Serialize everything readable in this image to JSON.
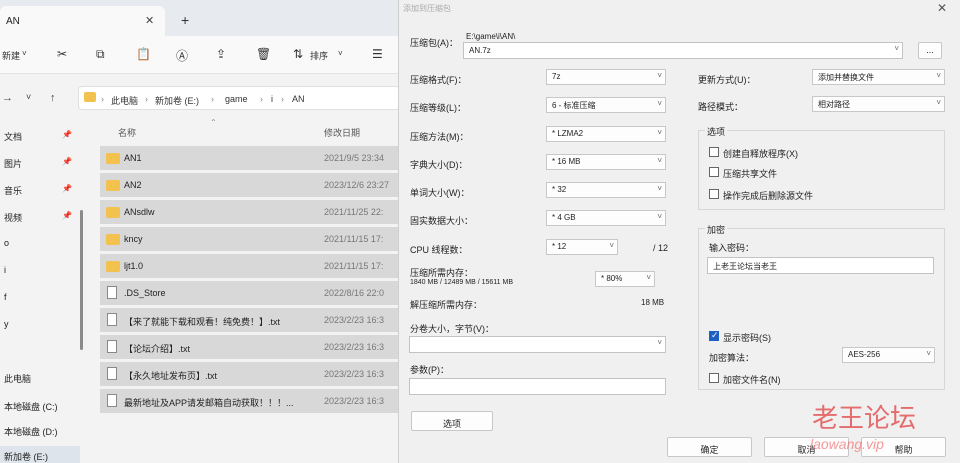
{
  "explorer": {
    "tab_title": "AN",
    "tab_close": "✕",
    "tab_new": "+",
    "toolbar": {
      "new_label": "新建",
      "sort_label": "排序"
    },
    "breadcrumb": [
      "此电脑",
      "新加卷 (E:)",
      "game",
      "i",
      "AN"
    ],
    "sidebar": [
      "文档",
      "图片",
      "音乐",
      "视频",
      "o",
      "i",
      "f",
      "y",
      "此电脑",
      "本地磁盘 (C:)",
      "本地磁盘 (D:)",
      "新加卷 (E:)"
    ],
    "columns": {
      "name": "名称",
      "date": "修改日期"
    },
    "files": [
      {
        "name": "AN1",
        "date": "2021/9/5 23:34",
        "type": "folder"
      },
      {
        "name": "AN2",
        "date": "2023/12/6 23:27",
        "type": "folder"
      },
      {
        "name": "ANsdlw",
        "date": "2021/11/25 22:",
        "type": "folder"
      },
      {
        "name": "kncy",
        "date": "2021/11/15 17:",
        "type": "folder"
      },
      {
        "name": "ljt1.0",
        "date": "2021/11/15 17:",
        "type": "folder"
      },
      {
        "name": ".DS_Store",
        "date": "2022/8/16 22:0",
        "type": "file"
      },
      {
        "name": "【来了就能下载和观看！纯免费！】.txt",
        "date": "2023/2/23 16:3",
        "type": "file"
      },
      {
        "name": "【论坛介绍】.txt",
        "date": "2023/2/23 16:3",
        "type": "file"
      },
      {
        "name": "【永久地址发布页】.txt",
        "date": "2023/2/23 16:3",
        "type": "file"
      },
      {
        "name": "最新地址及APP请发邮箱自动获取！！！...",
        "date": "2023/2/23 16:3",
        "type": "file"
      }
    ]
  },
  "dialog": {
    "title": "添加到压缩包",
    "archive_label": "压缩包(A)：",
    "archive_path": "E:\\game\\i\\AN\\",
    "archive_name": "AN.7z",
    "browse": "...",
    "format_label": "压缩格式(F)：",
    "format_value": "7z",
    "level_label": "压缩等级(L)：",
    "level_value": "6 - 标准压缩",
    "method_label": "压缩方法(M)：",
    "method_value": "* LZMA2",
    "dict_label": "字典大小(D)：",
    "dict_value": "* 16 MB",
    "word_label": "单词大小(W)：",
    "word_value": "* 32",
    "solid_label": "固实数据大小：",
    "solid_value": "* 4 GB",
    "cpu_label": "CPU 线程数：",
    "cpu_value": "* 12",
    "cpu_total": "/ 12",
    "mem_label": "压缩所需内存：",
    "mem_detail": "1840 MB / 12489 MB / 15611 MB",
    "mem_pct": "* 80%",
    "decomp_label": "解压缩所需内存：",
    "decomp_value": "18 MB",
    "split_label": "分卷大小，字节(V)：",
    "params_label": "参数(P)：",
    "options_button": "选项",
    "update_label": "更新方式(U)：",
    "update_value": "添加并替换文件",
    "path_label": "路径模式：",
    "path_value": "相对路径",
    "options_group": "选项",
    "opt_sfx": "创建自释放程序(X)",
    "opt_shared": "压缩共享文件",
    "opt_delete": "操作完成后删除源文件",
    "encrypt_group": "加密",
    "password_label": "输入密码：",
    "password_value": "上老王论坛当老王",
    "show_password": "显示密码(S)",
    "enc_method_label": "加密算法：",
    "enc_method_value": "AES-256",
    "encrypt_names": "加密文件名(N)",
    "ok": "确定",
    "cancel": "取消",
    "help": "帮助"
  },
  "watermark": {
    "text": "老王论坛",
    "url": "laowang.vip"
  }
}
